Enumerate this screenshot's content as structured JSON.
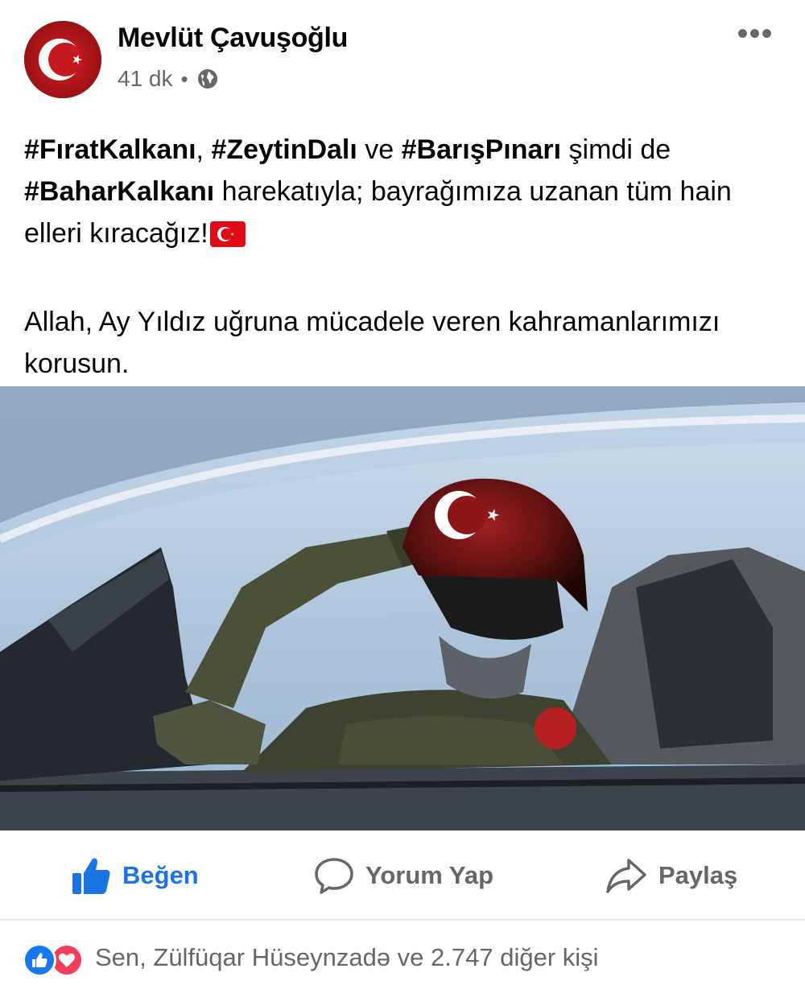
{
  "post": {
    "author": "Mevlüt Çavuşoğlu",
    "time": "41 dk",
    "separator": "•",
    "privacy_icon": "globe-icon",
    "more_icon": "more-options-icon",
    "more_label": "•••",
    "text": {
      "tag1": "#FıratKalkanı",
      "sep1": ", ",
      "tag2": "#ZeytinDalı",
      "sep2": " ve ",
      "tag3": "#BarışPınarı",
      "sep3": " şimdi de ",
      "tag4": "#BaharKalkanı",
      "rest1": " harekatıyla; bayrağımıza uzanan tüm hain elleri kıracağız!",
      "emoji": "turkey-flag-emoji",
      "paragraph2": "Allah, Ay Yıldız uğruna mücadele veren kahramanlarımızı korusun."
    },
    "image_description": "pilot-salute-photo"
  },
  "actions": {
    "like_label": "Beğen",
    "comment_label": "Yorum Yap",
    "share_label": "Paylaş"
  },
  "reactions": {
    "icons": [
      "like-reaction-icon",
      "love-reaction-icon"
    ],
    "summary": "Sen, Zülfüqar Hüseynzadə ve 2.747 diğer kişi"
  },
  "colors": {
    "text": "#050505",
    "secondary": "#65676b",
    "like_blue": "#1b74e4",
    "love_red": "#f33e58",
    "flag_red": "#e30a17"
  }
}
